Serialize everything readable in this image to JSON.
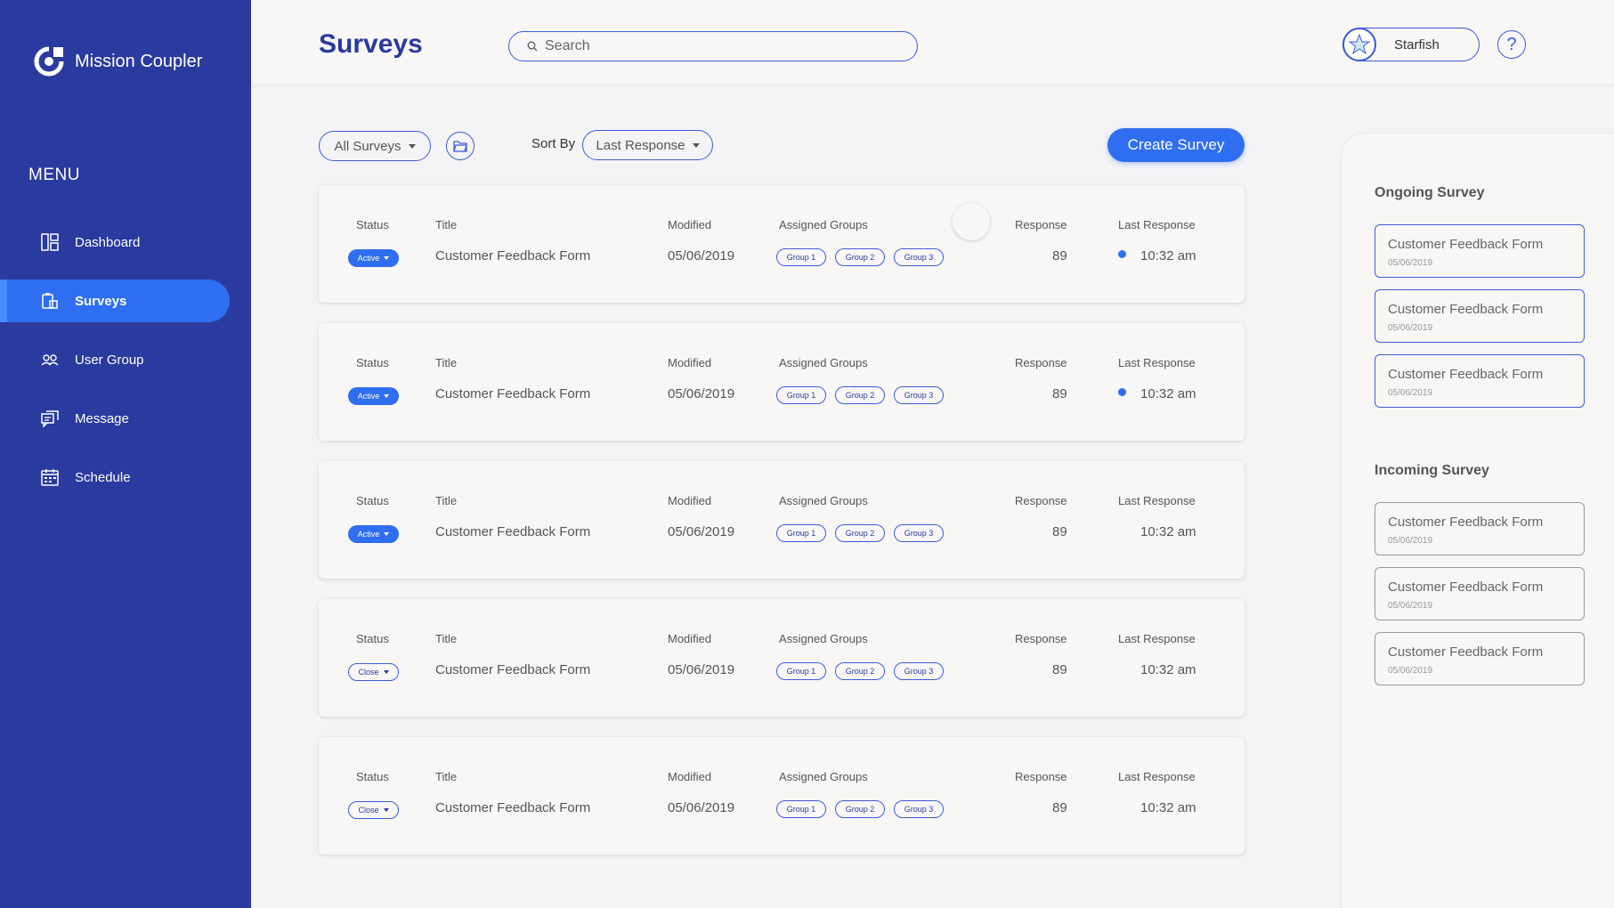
{
  "app": {
    "name": "Mission Coupler"
  },
  "sidebar": {
    "menu_title": "MENU",
    "items": [
      {
        "label": "Dashboard",
        "icon": "dashboard-icon",
        "active": false
      },
      {
        "label": "Surveys",
        "icon": "survey-icon",
        "active": true
      },
      {
        "label": "User Group",
        "icon": "users-icon",
        "active": false
      },
      {
        "label": "Message",
        "icon": "message-icon",
        "active": false
      },
      {
        "label": "Schedule",
        "icon": "calendar-icon",
        "active": false
      }
    ]
  },
  "header": {
    "title": "Surveys",
    "search_placeholder": "Search",
    "user_name": "Starfish",
    "help_label": "?"
  },
  "toolbar": {
    "filter_label": "All Surveys",
    "sort_label": "Sort By",
    "sort_value": "Last Response",
    "create_label": "Create Survey"
  },
  "columns": {
    "status": "Status",
    "title": "Title",
    "modified": "Modified",
    "groups": "Assigned Groups",
    "response": "Response",
    "last_response": "Last Response"
  },
  "surveys": [
    {
      "status": "Active",
      "title": "Customer Feedback Form",
      "modified": "05/06/2019",
      "groups": [
        "Group 1",
        "Group 2",
        "Group 3"
      ],
      "response": "89",
      "last_response": "10:32 am",
      "live": true
    },
    {
      "status": "Active",
      "title": "Customer Feedback Form",
      "modified": "05/06/2019",
      "groups": [
        "Group 1",
        "Group 2",
        "Group 3"
      ],
      "response": "89",
      "last_response": "10:32 am",
      "live": true
    },
    {
      "status": "Active",
      "title": "Customer Feedback Form",
      "modified": "05/06/2019",
      "groups": [
        "Group 1",
        "Group 2",
        "Group 3"
      ],
      "response": "89",
      "last_response": "10:32 am",
      "live": false
    },
    {
      "status": "Close",
      "title": "Customer Feedback Form",
      "modified": "05/06/2019",
      "groups": [
        "Group 1",
        "Group 2",
        "Group 3"
      ],
      "response": "89",
      "last_response": "10:32 am",
      "live": false
    },
    {
      "status": "Close",
      "title": "Customer Feedback Form",
      "modified": "05/06/2019",
      "groups": [
        "Group 1",
        "Group 2",
        "Group 3"
      ],
      "response": "89",
      "last_response": "10:32 am",
      "live": false
    }
  ],
  "right_panel": {
    "ongoing_title": "Ongoing Survey",
    "ongoing": [
      {
        "title": "Customer Feedback Form",
        "date": "05/06/2019"
      },
      {
        "title": "Customer Feedback Form",
        "date": "05/06/2019"
      },
      {
        "title": "Customer Feedback Form",
        "date": "05/06/2019"
      }
    ],
    "incoming_title": "Incoming Survey",
    "incoming": [
      {
        "title": "Customer Feedback Form",
        "date": "05/06/2019"
      },
      {
        "title": "Customer Feedback Form",
        "date": "05/06/2019"
      },
      {
        "title": "Customer Feedback Form",
        "date": "05/06/2019"
      }
    ]
  },
  "colors": {
    "sidebar": "#2a3a9e",
    "accent": "#2f6ef0",
    "outline": "#3d5bd8"
  }
}
